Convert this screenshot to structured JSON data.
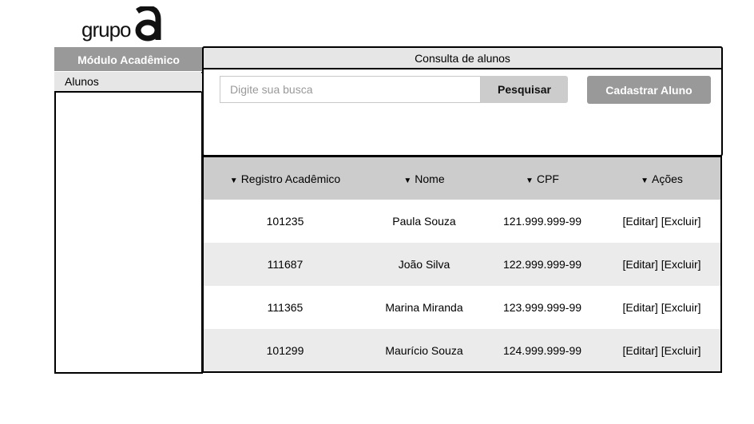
{
  "brand": {
    "logo_text": "grupo",
    "logo_letter": "a"
  },
  "sidebar": {
    "header": "Módulo Acadêmico",
    "items": [
      {
        "label": "Alunos",
        "selected": true
      }
    ]
  },
  "main": {
    "title": "Consulta de alunos",
    "search": {
      "placeholder": "Digite sua busca",
      "value": "",
      "button_label": "Pesquisar"
    },
    "add_button_label": "Cadastrar Aluno"
  },
  "table": {
    "columns": [
      {
        "label": "Registro Acadêmico",
        "icon": "sort-down-icon"
      },
      {
        "label": "Nome",
        "icon": "sort-down-icon"
      },
      {
        "label": "CPF",
        "icon": "sort-down-icon"
      },
      {
        "label": "Ações",
        "icon": "sort-down-icon"
      }
    ],
    "sort_glyph": "▼",
    "action_labels": {
      "edit": "[Editar]",
      "delete": "[Excluir]"
    },
    "rows": [
      {
        "registro": "101235",
        "nome": "Paula Souza",
        "cpf": "121.999.999-99"
      },
      {
        "registro": "111687",
        "nome": "João Silva",
        "cpf": "122.999.999-99"
      },
      {
        "registro": "111365",
        "nome": "Marina Miranda",
        "cpf": "123.999.999-99"
      },
      {
        "registro": "101299",
        "nome": "Maurício Souza",
        "cpf": "124.999.999-99"
      }
    ]
  },
  "colors": {
    "sidebar_header": "#999999",
    "panel_header": "#e6e6e6",
    "table_header": "#cccccc",
    "row_alt": "#ebebeb",
    "search_button": "#cccccc",
    "add_button": "#999999"
  }
}
